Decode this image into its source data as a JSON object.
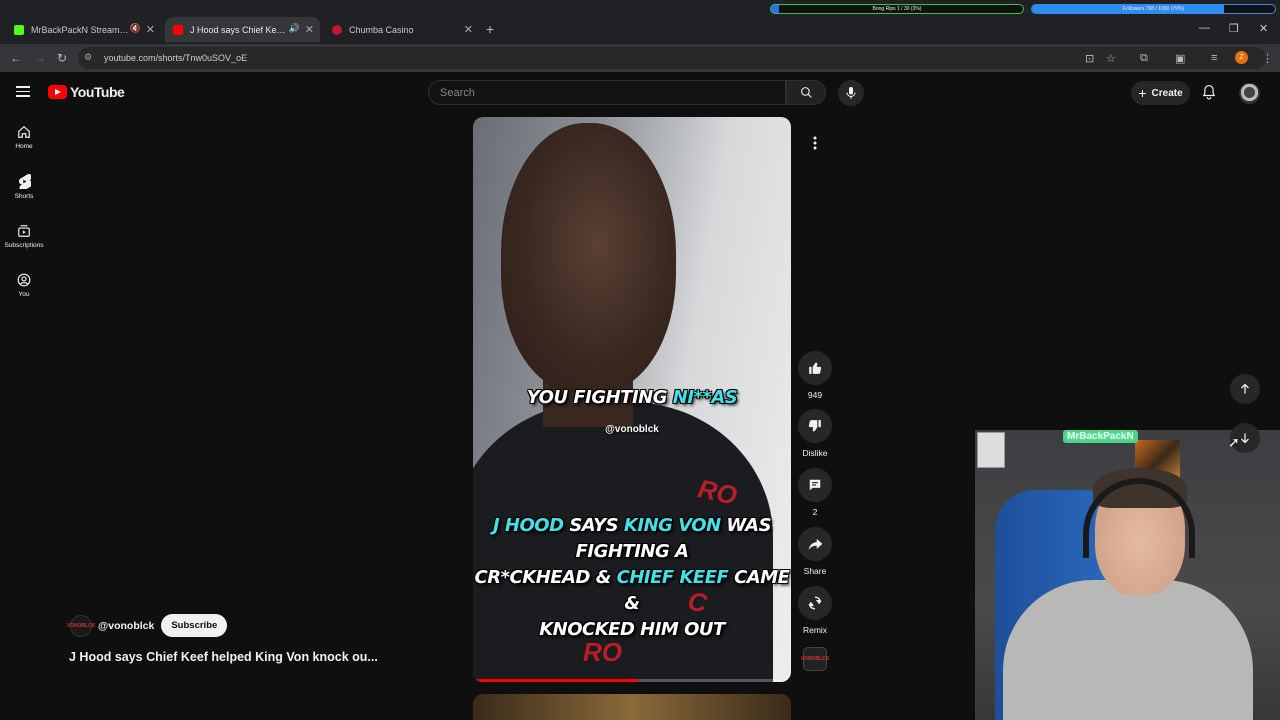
{
  "browser": {
    "tabs": [
      {
        "title": "MrBackPackN Stream - Wa",
        "favicon_color": "#53fc18",
        "active": false
      },
      {
        "title": "J Hood says Chief Keef help",
        "favicon_color": "#ff0000",
        "active": true
      },
      {
        "title": "Chumba Casino",
        "favicon_color": "#c4182c",
        "active": false
      }
    ],
    "url": "youtube.com/shorts/Tnw0uSOV_oE",
    "profile_initial": "Z"
  },
  "overlay_bars": {
    "left": {
      "label": "Bong Rips 1 / 30 (3%)",
      "progress": 0.03,
      "color": "#2e6cff"
    },
    "right": {
      "label": "Followers 798 / 1000 (79%)",
      "progress": 0.79,
      "color": "#2e8bf0"
    }
  },
  "youtube": {
    "logo_text": "YouTube",
    "search_placeholder": "Search",
    "create_label": "Create",
    "sidebar": [
      {
        "label": "Home",
        "icon": "home-icon"
      },
      {
        "label": "Shorts",
        "icon": "shorts-icon"
      },
      {
        "label": "Subscriptions",
        "icon": "subscriptions-icon"
      },
      {
        "label": "You",
        "icon": "user-icon"
      }
    ],
    "short": {
      "caption_top_plain": "YOU FIGHTING ",
      "caption_top_highlight": "NI**AS",
      "watermark": "@vonoblck",
      "caption_main": [
        {
          "text": "J HOOD",
          "hl": true
        },
        {
          "text": " SAYS ",
          "hl": false
        },
        {
          "text": "KING VON",
          "hl": true
        },
        {
          "text": " WAS FIGHTING A",
          "hl": false
        }
      ],
      "caption_main_2": [
        {
          "text": "CR*CKHEAD & ",
          "hl": false
        },
        {
          "text": "CHIEF KEEF",
          "hl": true
        },
        {
          "text": " CAME &",
          "hl": false
        }
      ],
      "caption_main_3": "KNOCKED HIM OUT",
      "progress": 0.52
    },
    "actions": {
      "like_count": "949",
      "dislike_label": "Dislike",
      "comment_count": "2",
      "share_label": "Share",
      "remix_label": "Remix"
    },
    "channel": {
      "handle": "@vonoblck",
      "subscribe_label": "Subscribe",
      "avatar_text": "VONOBLCK"
    },
    "video_title": "J Hood says Chief Keef helped King Von knock ou..."
  },
  "webcam": {
    "neon_sign": "MrBackPackN"
  }
}
